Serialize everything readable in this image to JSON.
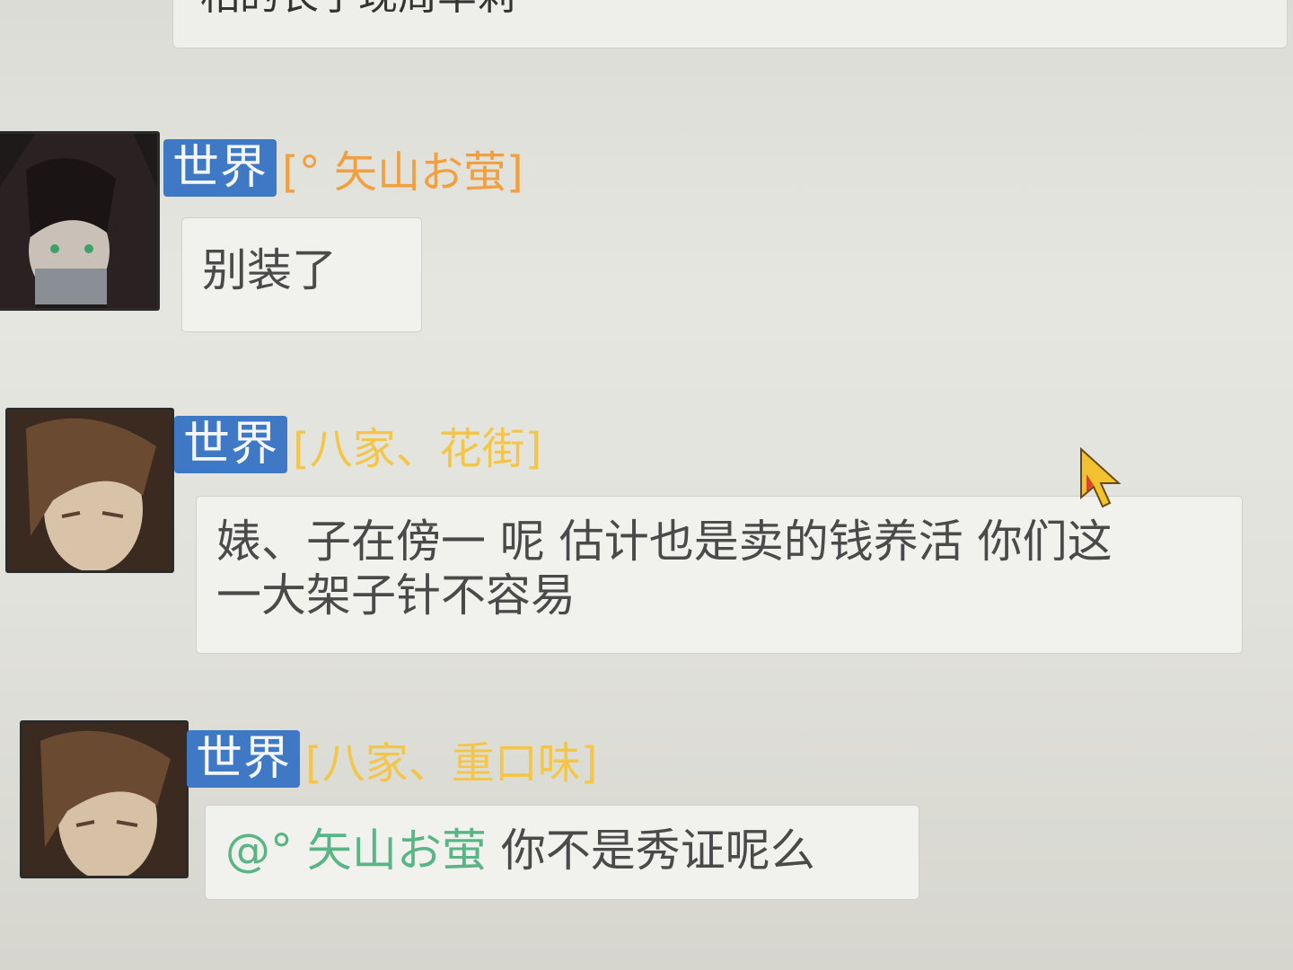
{
  "top_message": {
    "text": "相的长子现周羊莉"
  },
  "messages": [
    {
      "channel": "世界",
      "sender": "[°  矢山お萤]",
      "sender_color": "#f0a040",
      "text": "别装了"
    },
    {
      "channel": "世界",
      "sender": "[八家、花街]",
      "sender_color": "#f3c64a",
      "text_line1": "婊、子在傍一 呢 估计也是卖的钱养活 你们这",
      "text_line2": "一大架子针不容易"
    },
    {
      "channel": "世界",
      "sender": "[八家、重口味]",
      "sender_color": "#f3c64a",
      "mention": "@°  矢山お萤",
      "text": "你不是秀证呢么"
    }
  ],
  "colors": {
    "channel_bg": "#3f79c6",
    "mention": "#59b585"
  }
}
